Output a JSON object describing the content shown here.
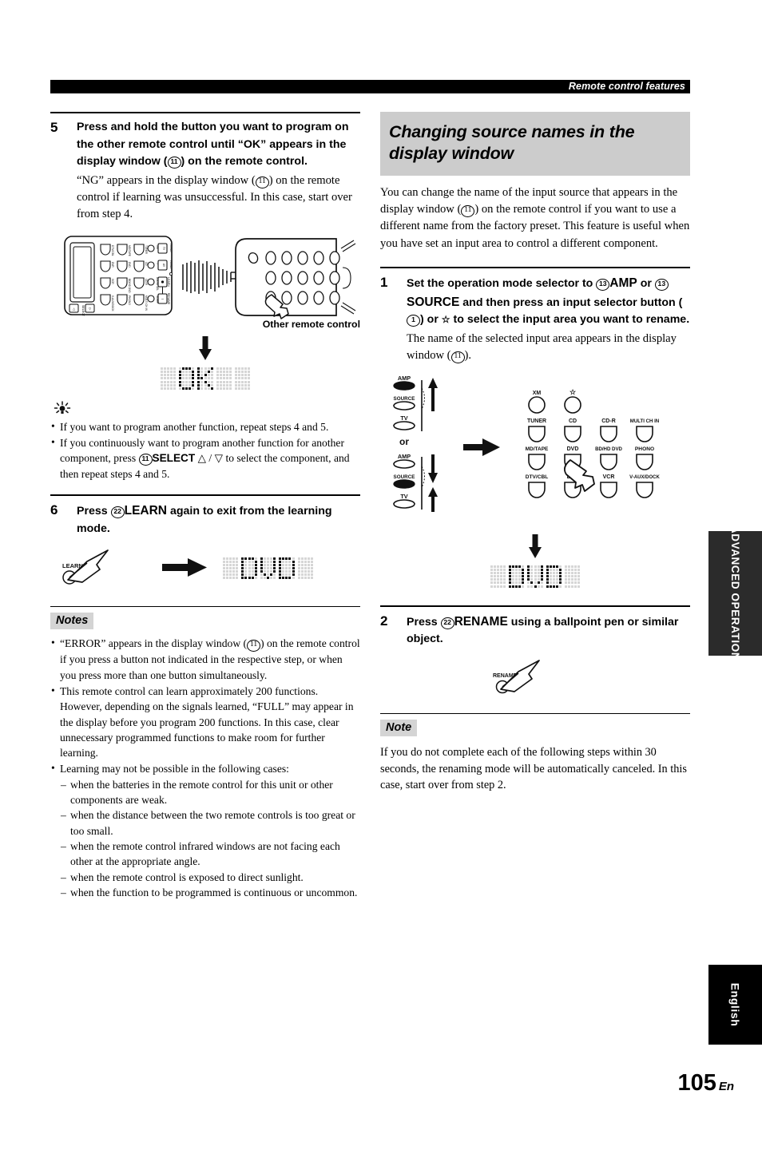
{
  "header": {
    "running_title": "Remote control features"
  },
  "left_column": {
    "step5": {
      "number": "5",
      "heading_parts": {
        "p1": "Press and hold the button you want to program on the other remote control until “OK” appears in the display window (",
        "ref": "11",
        "p2": ") on the remote control."
      },
      "body_parts": {
        "b1": "“NG” appears in the display window (",
        "ref": "11",
        "b2": ") on the remote control if learning was unsuccessful. In this case, start over from step 4."
      },
      "figure_caption": "Other remote control",
      "lcd_text": "OK"
    },
    "tips": [
      "If you want to program another function, repeat steps 4 and 5.",
      {
        "t1": "If you continuously want to program another function for another component, press ",
        "ref": "11",
        "t2": "SELECT",
        "t3": " △ / ▽ to select the component, and then repeat steps 4 and 5."
      }
    ],
    "step6": {
      "number": "6",
      "heading_p1": "Press ",
      "heading_ref": "22",
      "heading_bold": "LEARN",
      "heading_p2": " again to exit from the learning mode.",
      "button_label": "LEARN",
      "lcd_text": "DVD"
    },
    "notes_label": "Notes",
    "notes": [
      {
        "n1": "“ERROR” appears in the display window (",
        "ref": "11",
        "n2": ") on the remote control if you press a button not indicated in the respective step, or when you press more than one button simultaneously."
      },
      {
        "n1": "This remote control can learn approximately 200 functions. However, depending on the signals learned, “FULL” may appear in the display before you program 200 functions. In this case, clear unnecessary programmed functions to make room for further learning."
      },
      {
        "n1": "Learning may not be possible in the following cases:",
        "sub": [
          "when the batteries in the remote control for this unit or other components are weak.",
          "when the distance between the two remote controls is too great or too small.",
          "when the remote control infrared windows are not facing each other at the appropriate angle.",
          "when the remote control is exposed to direct sunlight.",
          "when the function to be programmed is continuous or uncommon."
        ]
      }
    ]
  },
  "right_column": {
    "section_title": "Changing source names in the display window",
    "intro_parts": {
      "i1": "You can change the name of the input source that appears in the display window (",
      "ref": "11",
      "i2": ") on the remote control if you want to use a different name from the factory preset. This feature is useful when you have set an input area to control a different component."
    },
    "step1": {
      "number": "1",
      "h1": "Set the operation mode selector to ",
      "ref1": "13",
      "bold1": "AMP",
      "h2": " or ",
      "ref2": "13",
      "bold2": "SOURCE",
      "h3": " and then press an input selector button (",
      "ref3": "1",
      "h4": ") or ",
      "star": "☆",
      "h5": " to select the input area you want to rename.",
      "body_b1": "The name of the selected input area appears in the display window (",
      "body_ref": "11",
      "body_b2": ").",
      "lcd_text": "DVD"
    },
    "mode_selector": {
      "or_label": "or",
      "top_switch": {
        "labels": [
          "AMP",
          "SOURCE",
          "TV"
        ],
        "active": "AMP"
      },
      "bottom_switch": {
        "labels": [
          "AMP",
          "SOURCE",
          "TV"
        ],
        "active": "SOURCE"
      }
    },
    "input_buttons": {
      "rows": [
        [
          "XM",
          "☆"
        ],
        [
          "TUNER",
          "CD",
          "CD-R",
          "MULTI CH IN"
        ],
        [
          "MD/TAPE",
          "DVD",
          "BD/HD DVD",
          "PHONO"
        ],
        [
          "DTV/CBL",
          "DVR",
          "VCR",
          "V-AUX/DOCK"
        ]
      ],
      "pressed": "DVD"
    },
    "step2": {
      "number": "2",
      "h1": "Press ",
      "ref": "22",
      "bold": "RENAME",
      "h2": " using a ballpoint pen or similar object.",
      "button_label": "RENAME"
    },
    "note_label": "Note",
    "note_text": "If you do not complete each of the following steps within 30 seconds, the renaming mode will be automatically canceled. In this case, start over from step 2."
  },
  "side_tabs": {
    "advanced": "ADVANCED OPERATION",
    "english": "English"
  },
  "page": {
    "number": "105",
    "suffix": "En"
  },
  "colors": {
    "header_bar": "#000000",
    "section_head_bg": "#cccccc",
    "note_label_bg": "#d4d4d4",
    "tab_advanced_bg": "#2b2b2b",
    "tab_english_bg": "#000000"
  }
}
